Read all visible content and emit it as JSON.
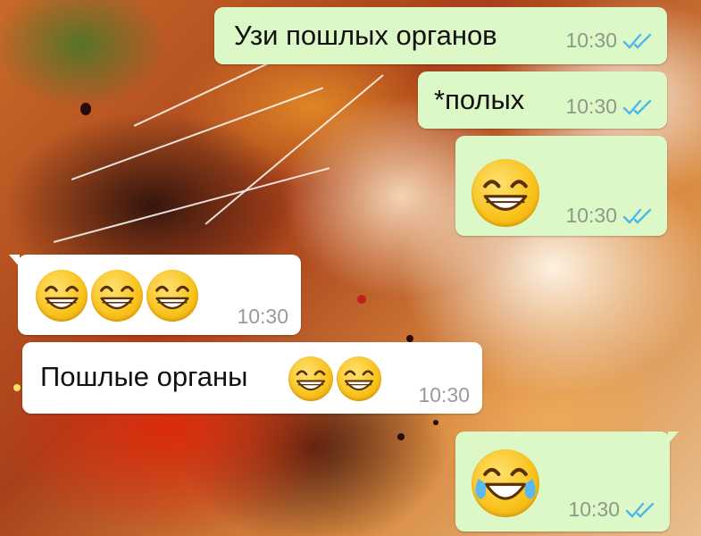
{
  "chat": {
    "messages": [
      {
        "direction": "outgoing",
        "text": "Узи пошлых органов",
        "time": "10:30",
        "status_icon": "double-check-read-icon"
      },
      {
        "direction": "outgoing",
        "text": "*полых",
        "time": "10:30",
        "status_icon": "double-check-read-icon"
      },
      {
        "direction": "outgoing",
        "emojis": [
          "grinning-face-smiling-eyes"
        ],
        "time": "10:30",
        "status_icon": "double-check-read-icon"
      },
      {
        "direction": "incoming",
        "emojis": [
          "grinning-face-smiling-eyes",
          "grinning-face-smiling-eyes",
          "grinning-face-smiling-eyes"
        ],
        "time": "10:30"
      },
      {
        "direction": "incoming",
        "text": "Пошлые органы",
        "emojis": [
          "grinning-face-smiling-eyes",
          "grinning-face-smiling-eyes"
        ],
        "time": "10:30"
      },
      {
        "direction": "outgoing",
        "emojis": [
          "face-with-tears-of-joy"
        ],
        "time": "10:30",
        "status_icon": "double-check-read-icon"
      }
    ]
  },
  "colors": {
    "outgoing_bubble": "#dcf8c6",
    "incoming_bubble": "#ffffff",
    "read_ticks": "#4fb6ec",
    "timestamp": "#8a9a8a"
  }
}
